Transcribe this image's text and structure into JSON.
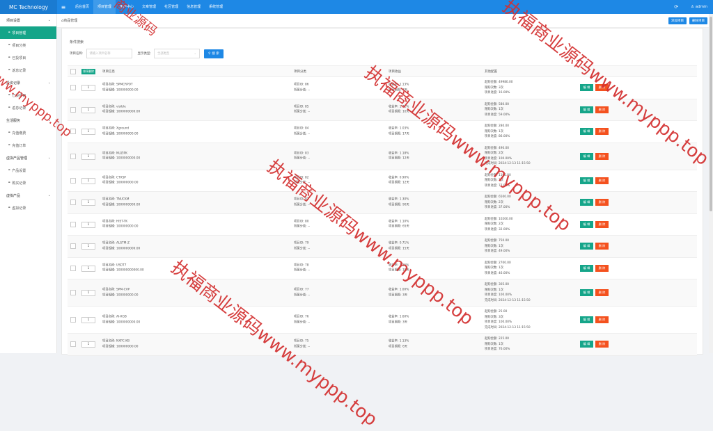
{
  "brand": "MC Technology",
  "topnav": [
    "后台首页",
    "项目管理",
    "用户中心",
    "文章管理",
    "社区管理",
    "信息管理",
    "系统管理"
  ],
  "topnav_active": 1,
  "user": "admin",
  "sidebar": {
    "groups": [
      {
        "label": "项目设置",
        "items": [
          "项目管理",
          "项目分类",
          "已投项目",
          "返息记录"
        ]
      },
      {
        "label": "投资记录",
        "items": [
          "已投项目",
          "返息记录"
        ]
      },
      {
        "label": "生活服务",
        "items": [
          "充值缴费",
          "充值订单"
        ]
      },
      {
        "label": "虚拟产品管理",
        "items": [
          "产品设置",
          "购买记录"
        ]
      },
      {
        "label": "虚拟产品",
        "items": [
          "虚拟记录"
        ]
      }
    ]
  },
  "breadcrumb": "商品管理",
  "actions": {
    "add": "添加项目",
    "delete": "删除项目"
  },
  "search": {
    "title": "条件搜索",
    "name_label": "项目名称:",
    "name_placeholder": "请输入项目名称",
    "type_label": "显示类型:",
    "type_value": "全部类型",
    "button": "搜 索"
  },
  "table": {
    "sort_button": "排序删除",
    "headers": {
      "info": "项目信息",
      "category": "项目分类",
      "rate": "项目收益",
      "other": "其他配置"
    },
    "edit_label": "编 辑",
    "delete_label": "删 除",
    "rows": [
      {
        "sort": "1",
        "info": [
          "项目名称: SPMCRPOT",
          "项目规模: 100000000.00"
        ],
        "category": [
          "项目ID: 86",
          "所属分类: --"
        ],
        "rate": [
          "收益率: 1.13%",
          "项目期限: 7天"
        ],
        "other": [
          "起购金额: 49980.00",
          "限购次数: 3次",
          "项目进度: 16.00%"
        ]
      },
      {
        "sort": "1",
        "info": [
          "项目名称: visible",
          "项目规模: 1000000000.00"
        ],
        "category": [
          "项目ID: 85",
          "所属分类: --"
        ],
        "rate": [
          "收益率: 1.71%",
          "项目期限: 10天"
        ],
        "other": [
          "起购金额: 580.00",
          "限购次数: 1次",
          "项目进度: 59.00%"
        ]
      },
      {
        "sort": "1",
        "info": [
          "项目名称: Xground",
          "项目规模: 100000000.00"
        ],
        "category": [
          "项目ID: 84",
          "所属分类: --"
        ],
        "rate": [
          "收益率: 1.03%",
          "项目期限: 17天"
        ],
        "other": [
          "起购金额: 280.00",
          "限购次数: 1次",
          "项目进度: 86.00%"
        ]
      },
      {
        "sort": "1",
        "info": [
          "项目名称: NUZIPK",
          "项目规模: 1000000000.00"
        ],
        "category": [
          "项目ID: 83",
          "所属分类: --"
        ],
        "rate": [
          "收益率: 1.18%",
          "项目期限: 12天"
        ],
        "other": [
          "起购金额: 490.00",
          "限购次数: 2次",
          "项目进度: 100.00%",
          "完成时间: 2024-12-13 11:15:50"
        ]
      },
      {
        "sort": "1",
        "info": [
          "项目名称: CTXSP",
          "项目规模: 100000000.00"
        ],
        "category": [
          "项目ID: 82",
          "所属分类: --"
        ],
        "rate": [
          "收益率: 0.90%",
          "项目期限: 12天"
        ],
        "other": [
          "起购金额: 1100.00",
          "限购次数: 1次",
          "项目进度: 77.00%"
        ]
      },
      {
        "sort": "1",
        "info": [
          "项目名称: TNUCKM",
          "项目规模: 1000000000.00"
        ],
        "category": [
          "项目ID: 81",
          "所属分类: --"
        ],
        "rate": [
          "收益率: 1.30%",
          "项目期限: 90天"
        ],
        "other": [
          "起购金额: 6500.00",
          "限购次数: 2次",
          "项目进度: 37.00%"
        ]
      },
      {
        "sort": "1",
        "info": [
          "项目名称: HIST-TK",
          "项目规模: 100000000.00"
        ],
        "category": [
          "项目ID: 80",
          "所属分类: --"
        ],
        "rate": [
          "收益率: 1.10%",
          "项目期限: 65天"
        ],
        "other": [
          "起购金额: 10200.00",
          "限购次数: 2次",
          "项目进度: 32.00%"
        ]
      },
      {
        "sort": "1",
        "info": [
          "项目名称: ALSTM-Z",
          "项目规模: 1000000000.00"
        ],
        "category": [
          "项目ID: 79",
          "所属分类: --"
        ],
        "rate": [
          "收益率: 0.71%",
          "项目期限: 15天"
        ],
        "other": [
          "起购金额: 750.00",
          "限购次数: 1次",
          "项目进度: 49.00%"
        ]
      },
      {
        "sort": "1",
        "info": [
          "项目名称: USDT7",
          "项目规模: 100000000000.00"
        ],
        "category": [
          "项目ID: 78",
          "所属分类: --"
        ],
        "rate": [
          "收益率: 1.15%",
          "项目期限: 15天"
        ],
        "other": [
          "起购金额: 2700.00",
          "限购次数: 1次",
          "项目进度: 46.00%"
        ]
      },
      {
        "sort": "1",
        "info": [
          "项目名称: SPM-CVP",
          "项目规模: 100000000.00"
        ],
        "category": [
          "项目ID: 77",
          "所属分类: --"
        ],
        "rate": [
          "收益率: 1.00%",
          "项目期限: 3天"
        ],
        "other": [
          "起购金额: 305.00",
          "限购次数: 1次",
          "项目进度: 100.00%",
          "完成时间: 2024-12-13 11:15:50"
        ]
      },
      {
        "sort": "1",
        "info": [
          "项目名称: AI-XGB",
          "项目规模: 1000000000.00"
        ],
        "category": [
          "项目ID: 76",
          "所属分类: --"
        ],
        "rate": [
          "收益率: 1.60%",
          "项目期限: 3天"
        ],
        "other": [
          "起购金额: 25.00",
          "限购次数: 3次",
          "项目进度: 100.00%",
          "完成时间: 2024-12-13 11:15:50"
        ]
      },
      {
        "sort": "1",
        "info": [
          "项目名称: NXPC-KB",
          "项目规模: 100000000.00"
        ],
        "category": [
          "项目ID: 75",
          "所属分类: --"
        ],
        "rate": [
          "收益率: 1.13%",
          "项目期限: 6天"
        ],
        "other": [
          "起购金额: 225.00",
          "限购次数: 1次",
          "项目进度: 76.00%"
        ]
      }
    ]
  },
  "watermarks": [
    "执福商业源码www.myppp.top",
    "执福商业源码www.myppp.top",
    "执福商业源码www.myppp.top",
    "www.myppp.top",
    "商业源码"
  ]
}
